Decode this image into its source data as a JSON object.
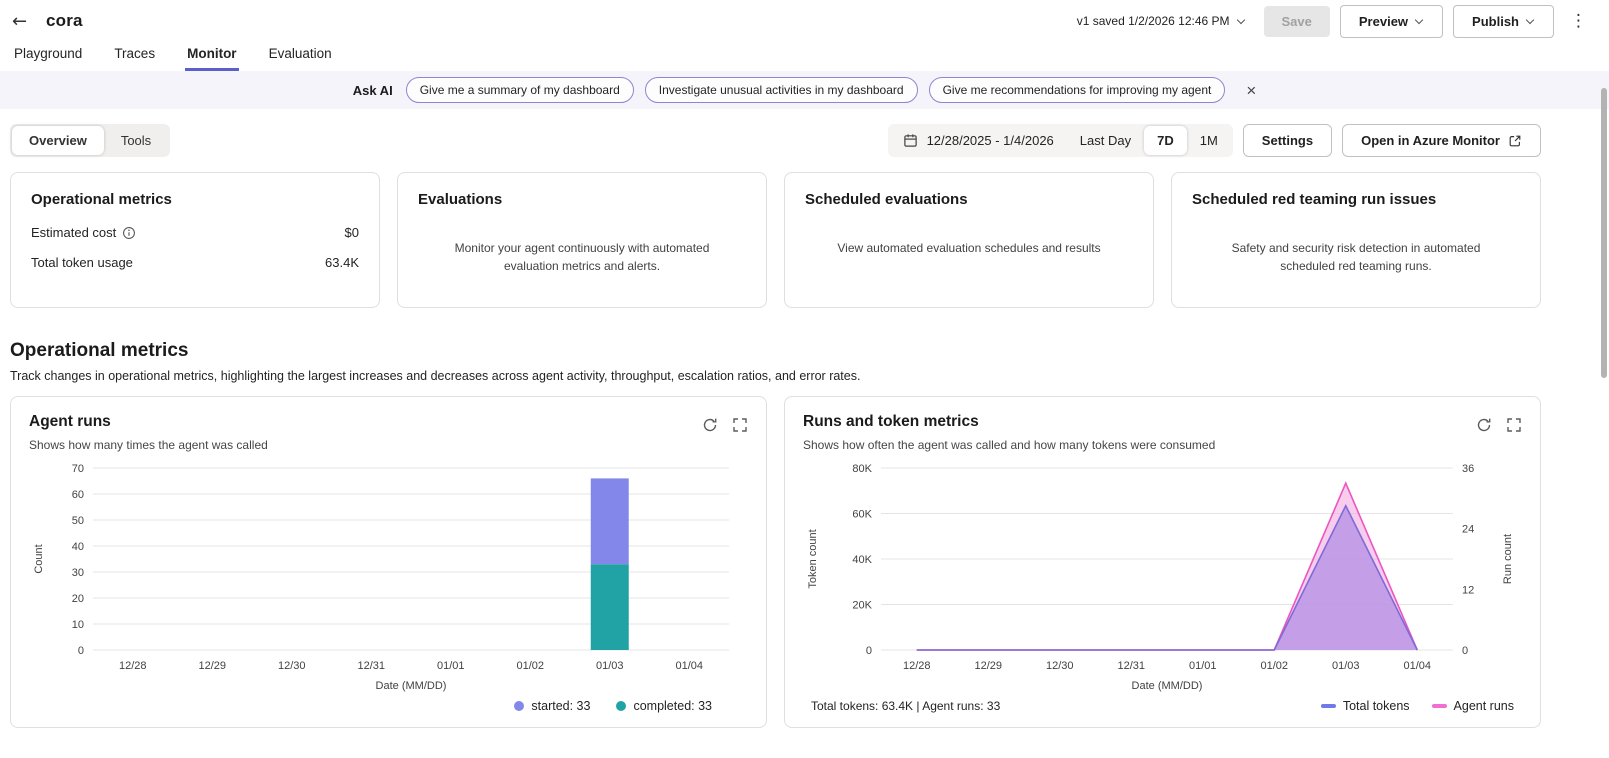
{
  "theme": {
    "accent": "#5b5fc7"
  },
  "icons": {
    "back": "←",
    "more": "⋮",
    "close": "×"
  },
  "header": {
    "title": "cora",
    "version_status": "v1 saved 1/2/2026 12:46 PM",
    "save_label": "Save",
    "preview_label": "Preview",
    "publish_label": "Publish"
  },
  "tabs": [
    {
      "label": "Playground"
    },
    {
      "label": "Traces"
    },
    {
      "label": "Monitor"
    },
    {
      "label": "Evaluation"
    }
  ],
  "ask_ai": {
    "label": "Ask AI",
    "suggestions": [
      "Give me a summary of my dashboard",
      "Investigate unusual activities in my dashboard",
      "Give me recommendations for improving my agent"
    ]
  },
  "toolbar": {
    "overview_label": "Overview",
    "tools_label": "Tools",
    "date_range": "12/28/2025 - 1/4/2026",
    "last_day_label": "Last Day",
    "seven_day_label": "7D",
    "one_month_label": "1M",
    "settings_label": "Settings",
    "azure_monitor_label": "Open in Azure Monitor"
  },
  "summary_cards": {
    "operational": {
      "title": "Operational metrics",
      "rows": [
        {
          "label": "Estimated cost",
          "value": "$0"
        },
        {
          "label": "Total token usage",
          "value": "63.4K"
        }
      ]
    },
    "evaluations": {
      "title": "Evaluations",
      "description": "Monitor your agent continuously with automated evaluation metrics and alerts."
    },
    "scheduled_evaluations": {
      "title": "Scheduled evaluations",
      "description": "View automated evaluation schedules and results"
    },
    "red_teaming": {
      "title": "Scheduled red teaming run issues",
      "description": "Safety and security risk detection in automated scheduled red teaming runs."
    }
  },
  "section": {
    "title": "Operational metrics",
    "description": "Track changes in operational metrics, highlighting the largest increases and decreases across agent activity, throughput, escalation ratios, and error rates."
  },
  "chart_data": [
    {
      "type": "bar",
      "stacked": true,
      "title": "Agent runs",
      "subtitle": "Shows how many times the agent was called",
      "categories": [
        "12/28",
        "12/29",
        "12/30",
        "12/31",
        "01/01",
        "01/02",
        "01/03",
        "01/04"
      ],
      "series": [
        {
          "name": "started",
          "legend_label": "started: 33",
          "color": "#8487ea",
          "values": [
            0,
            0,
            0,
            0,
            0,
            0,
            33,
            0
          ]
        },
        {
          "name": "completed",
          "legend_label": "completed: 33",
          "color": "#21a3a6",
          "values": [
            0,
            0,
            0,
            0,
            0,
            0,
            33,
            0
          ]
        }
      ],
      "xlabel": "Date (MM/DD)",
      "ylabel": "Count",
      "ylim": [
        0,
        70
      ],
      "yticks": [
        0,
        10,
        20,
        30,
        40,
        50,
        60,
        70
      ],
      "grid": true,
      "legend_position": "bottom-right"
    },
    {
      "type": "area",
      "title": "Runs and token metrics",
      "subtitle": "Shows how often the agent was called and how many tokens were consumed",
      "categories": [
        "12/28",
        "12/29",
        "12/30",
        "12/31",
        "01/01",
        "01/02",
        "01/03",
        "01/04"
      ],
      "series": [
        {
          "name": "Agent runs",
          "axis": "right",
          "line_color": "#ea57c0",
          "fill_color": "#f2a3dd",
          "fill_opacity": 0.55,
          "values": [
            0,
            0,
            0,
            0,
            0,
            0,
            33,
            0
          ]
        },
        {
          "name": "Total tokens",
          "axis": "left",
          "line_color": "#7e6bd9",
          "fill_color": "#b794e6",
          "fill_opacity": 0.8,
          "values": [
            0,
            0,
            0,
            0,
            0,
            0,
            63400,
            0
          ]
        }
      ],
      "xlabel": "Date (MM/DD)",
      "ylabel_left": "Token count",
      "ylabel_right": "Run count",
      "ylim_left": [
        0,
        80000
      ],
      "yticks_left": [
        {
          "v": 0,
          "label": "0"
        },
        {
          "v": 20000,
          "label": "20K"
        },
        {
          "v": 40000,
          "label": "40K"
        },
        {
          "v": 60000,
          "label": "60K"
        },
        {
          "v": 80000,
          "label": "80K"
        }
      ],
      "ylim_right": [
        0,
        36
      ],
      "yticks_right": [
        {
          "v": 0,
          "label": "0"
        },
        {
          "v": 12,
          "label": "12"
        },
        {
          "v": 24,
          "label": "24"
        },
        {
          "v": 36,
          "label": "36"
        }
      ],
      "grid": true,
      "footer": "Total tokens: 63.4K | Agent runs: 33",
      "legend": [
        {
          "label": "Total tokens",
          "color": "#6f7ae8"
        },
        {
          "label": "Agent runs",
          "color": "#f06fd0"
        }
      ],
      "legend_position": "bottom-right"
    }
  ]
}
